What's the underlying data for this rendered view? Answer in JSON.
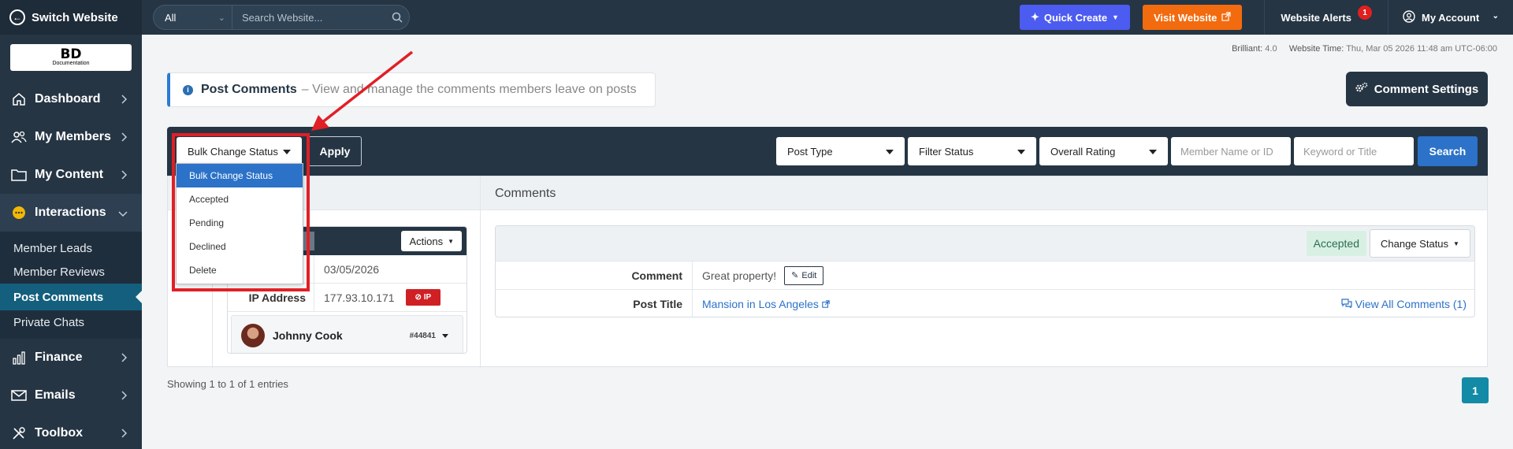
{
  "sidebar": {
    "switch_label": "Switch Website",
    "logo_text": "BD",
    "logo_sub": "Documentation",
    "items": [
      {
        "label": "Dashboard",
        "icon": "home-icon"
      },
      {
        "label": "My Members",
        "icon": "users-icon"
      },
      {
        "label": "My Content",
        "icon": "folder-icon"
      },
      {
        "label": "Interactions",
        "icon": "chat-icon"
      },
      {
        "label": "Finance",
        "icon": "bar-chart-icon"
      },
      {
        "label": "Emails",
        "icon": "envelope-icon"
      },
      {
        "label": "Toolbox",
        "icon": "tools-icon"
      }
    ],
    "subitems": [
      "Member Leads",
      "Member Reviews",
      "Post Comments",
      "Private Chats"
    ]
  },
  "topbar": {
    "scope": "All",
    "search_placeholder": "Search Website...",
    "quick_create": "Quick Create",
    "visit_website": "Visit Website",
    "website_alerts": "Website Alerts",
    "alerts_count": "1",
    "my_account": "My Account"
  },
  "meta": {
    "version_label": "Brilliant:",
    "version": "4.0",
    "time_label": "Website Time:",
    "time": "Thu, Mar 05 2026 11:48 am UTC-06:00"
  },
  "page": {
    "title": "Post Comments",
    "subtitle": "– View and manage the comments members leave on posts",
    "settings_button": "Comment Settings"
  },
  "filters": {
    "bulk_label": "Bulk Change Status",
    "apply": "Apply",
    "post_type": "Post Type",
    "filter_status": "Filter Status",
    "overall_rating": "Overall Rating",
    "member_placeholder": "Member Name or ID",
    "keyword_placeholder": "Keyword or Title",
    "search": "Search",
    "bulk_options": [
      "Bulk Change Status",
      "Accepted",
      "Pending",
      "Declined",
      "Delete"
    ]
  },
  "table": {
    "comments_header": "Comments"
  },
  "member_card": {
    "actions": "Actions",
    "date": "03/05/2026",
    "ip_label": "IP Address",
    "ip_value": "177.93.10.171",
    "ip_badge": "IP",
    "user_name": "Johnny Cook",
    "user_id": "#44841"
  },
  "comment_card": {
    "status": "Accepted",
    "change_status": "Change Status",
    "comment_label": "Comment",
    "comment_value": "Great property!",
    "edit": "Edit",
    "post_title_label": "Post Title",
    "post_title_value": "Mansion in Los Angeles",
    "view_all": "View All Comments (1)"
  },
  "footer": {
    "showing": "Showing 1 to 1 of 1 entries",
    "page": "1"
  },
  "colors": {
    "sidebar": "#253544",
    "quick_create": "#4c5bf0",
    "visit_website": "#f26b0f",
    "active_sub": "#135f7d",
    "search_button": "#2b72c8",
    "annotation": "#e01f26"
  }
}
